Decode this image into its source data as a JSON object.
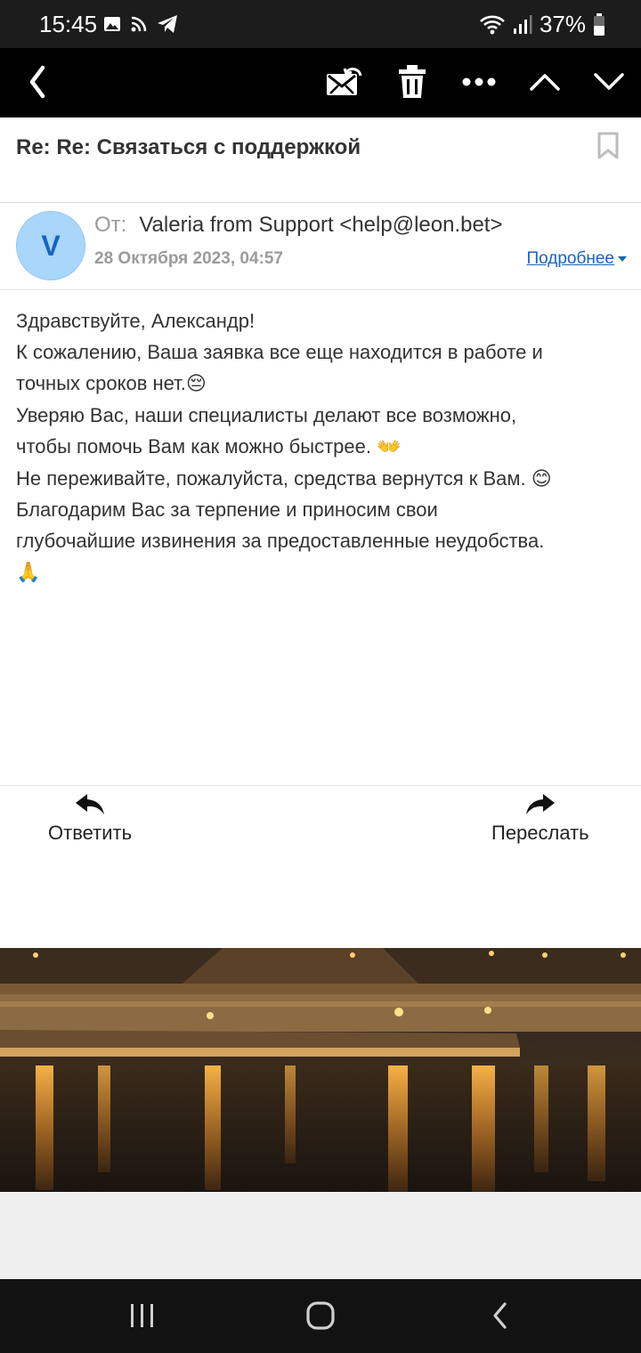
{
  "status_bar": {
    "time": "15:45",
    "battery": "37%",
    "left_icons": [
      "image-icon",
      "rss-icon",
      "telegram-icon"
    ],
    "right_icons": [
      "wifi-icon",
      "signal-icon",
      "battery-icon"
    ]
  },
  "toolbar": {
    "icons": [
      "back-icon",
      "mark-unread-icon",
      "trash-icon",
      "more-icon",
      "previous-icon",
      "next-icon"
    ]
  },
  "email": {
    "subject": "Re: Re: Связаться с поддержкой",
    "avatar_letter": "V",
    "from_label": "От:",
    "from": "Valeria from Support <help@leon.bet>",
    "date": "28 Октября 2023, 04:57",
    "details_link": "Подробнее",
    "body_lines": [
      "Здравствуйте, Александр!",
      "К сожалению, Ваша заявка все еще находится в работе и",
      "точных сроков нет.",
      "Уверяю Вас, наши специалисты делают все возможно,",
      "чтобы помочь Вам как можно быстрее.",
      "Не переживайте, пожалуйста, средства вернутся к Вам.",
      "Благодарим Вас за терпение и приносим свои",
      "глубочайшие извинения за предоставленные неудобства."
    ],
    "emojis": [
      "😔",
      "👐",
      "😊",
      "🙏"
    ]
  },
  "actions": {
    "reply": "Ответить",
    "forward": "Переслать"
  },
  "colors": {
    "accent": "#1565c0",
    "avatar_bg": "#a9d6fb",
    "toolbar_bg": "#000000"
  },
  "nav_bar": {
    "icons": [
      "recent-apps-icon",
      "home-icon",
      "back-nav-icon"
    ]
  }
}
